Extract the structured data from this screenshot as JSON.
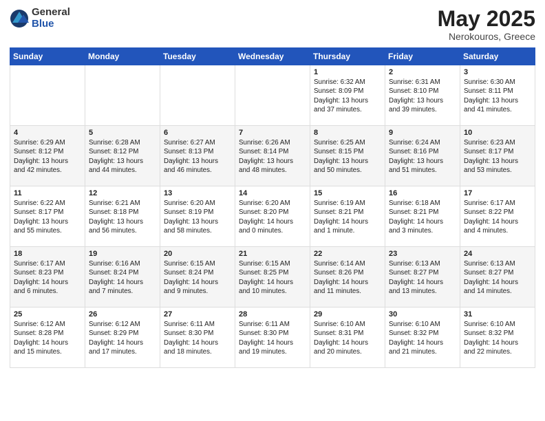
{
  "logo": {
    "general": "General",
    "blue": "Blue"
  },
  "title": "May 2025",
  "location": "Nerokouros, Greece",
  "days_header": [
    "Sunday",
    "Monday",
    "Tuesday",
    "Wednesday",
    "Thursday",
    "Friday",
    "Saturday"
  ],
  "weeks": [
    [
      {
        "day": "",
        "info": ""
      },
      {
        "day": "",
        "info": ""
      },
      {
        "day": "",
        "info": ""
      },
      {
        "day": "",
        "info": ""
      },
      {
        "day": "1",
        "info": "Sunrise: 6:32 AM\nSunset: 8:09 PM\nDaylight: 13 hours\nand 37 minutes."
      },
      {
        "day": "2",
        "info": "Sunrise: 6:31 AM\nSunset: 8:10 PM\nDaylight: 13 hours\nand 39 minutes."
      },
      {
        "day": "3",
        "info": "Sunrise: 6:30 AM\nSunset: 8:11 PM\nDaylight: 13 hours\nand 41 minutes."
      }
    ],
    [
      {
        "day": "4",
        "info": "Sunrise: 6:29 AM\nSunset: 8:12 PM\nDaylight: 13 hours\nand 42 minutes."
      },
      {
        "day": "5",
        "info": "Sunrise: 6:28 AM\nSunset: 8:12 PM\nDaylight: 13 hours\nand 44 minutes."
      },
      {
        "day": "6",
        "info": "Sunrise: 6:27 AM\nSunset: 8:13 PM\nDaylight: 13 hours\nand 46 minutes."
      },
      {
        "day": "7",
        "info": "Sunrise: 6:26 AM\nSunset: 8:14 PM\nDaylight: 13 hours\nand 48 minutes."
      },
      {
        "day": "8",
        "info": "Sunrise: 6:25 AM\nSunset: 8:15 PM\nDaylight: 13 hours\nand 50 minutes."
      },
      {
        "day": "9",
        "info": "Sunrise: 6:24 AM\nSunset: 8:16 PM\nDaylight: 13 hours\nand 51 minutes."
      },
      {
        "day": "10",
        "info": "Sunrise: 6:23 AM\nSunset: 8:17 PM\nDaylight: 13 hours\nand 53 minutes."
      }
    ],
    [
      {
        "day": "11",
        "info": "Sunrise: 6:22 AM\nSunset: 8:17 PM\nDaylight: 13 hours\nand 55 minutes."
      },
      {
        "day": "12",
        "info": "Sunrise: 6:21 AM\nSunset: 8:18 PM\nDaylight: 13 hours\nand 56 minutes."
      },
      {
        "day": "13",
        "info": "Sunrise: 6:20 AM\nSunset: 8:19 PM\nDaylight: 13 hours\nand 58 minutes."
      },
      {
        "day": "14",
        "info": "Sunrise: 6:20 AM\nSunset: 8:20 PM\nDaylight: 14 hours\nand 0 minutes."
      },
      {
        "day": "15",
        "info": "Sunrise: 6:19 AM\nSunset: 8:21 PM\nDaylight: 14 hours\nand 1 minute."
      },
      {
        "day": "16",
        "info": "Sunrise: 6:18 AM\nSunset: 8:21 PM\nDaylight: 14 hours\nand 3 minutes."
      },
      {
        "day": "17",
        "info": "Sunrise: 6:17 AM\nSunset: 8:22 PM\nDaylight: 14 hours\nand 4 minutes."
      }
    ],
    [
      {
        "day": "18",
        "info": "Sunrise: 6:17 AM\nSunset: 8:23 PM\nDaylight: 14 hours\nand 6 minutes."
      },
      {
        "day": "19",
        "info": "Sunrise: 6:16 AM\nSunset: 8:24 PM\nDaylight: 14 hours\nand 7 minutes."
      },
      {
        "day": "20",
        "info": "Sunrise: 6:15 AM\nSunset: 8:24 PM\nDaylight: 14 hours\nand 9 minutes."
      },
      {
        "day": "21",
        "info": "Sunrise: 6:15 AM\nSunset: 8:25 PM\nDaylight: 14 hours\nand 10 minutes."
      },
      {
        "day": "22",
        "info": "Sunrise: 6:14 AM\nSunset: 8:26 PM\nDaylight: 14 hours\nand 11 minutes."
      },
      {
        "day": "23",
        "info": "Sunrise: 6:13 AM\nSunset: 8:27 PM\nDaylight: 14 hours\nand 13 minutes."
      },
      {
        "day": "24",
        "info": "Sunrise: 6:13 AM\nSunset: 8:27 PM\nDaylight: 14 hours\nand 14 minutes."
      }
    ],
    [
      {
        "day": "25",
        "info": "Sunrise: 6:12 AM\nSunset: 8:28 PM\nDaylight: 14 hours\nand 15 minutes."
      },
      {
        "day": "26",
        "info": "Sunrise: 6:12 AM\nSunset: 8:29 PM\nDaylight: 14 hours\nand 17 minutes."
      },
      {
        "day": "27",
        "info": "Sunrise: 6:11 AM\nSunset: 8:30 PM\nDaylight: 14 hours\nand 18 minutes."
      },
      {
        "day": "28",
        "info": "Sunrise: 6:11 AM\nSunset: 8:30 PM\nDaylight: 14 hours\nand 19 minutes."
      },
      {
        "day": "29",
        "info": "Sunrise: 6:10 AM\nSunset: 8:31 PM\nDaylight: 14 hours\nand 20 minutes."
      },
      {
        "day": "30",
        "info": "Sunrise: 6:10 AM\nSunset: 8:32 PM\nDaylight: 14 hours\nand 21 minutes."
      },
      {
        "day": "31",
        "info": "Sunrise: 6:10 AM\nSunset: 8:32 PM\nDaylight: 14 hours\nand 22 minutes."
      }
    ]
  ]
}
